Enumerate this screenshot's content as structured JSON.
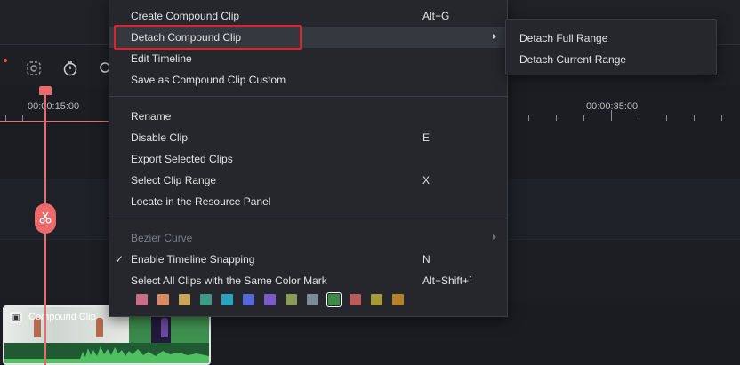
{
  "timeline": {
    "ruler_labels": [
      "00:00:15:00",
      "00:00:35:00"
    ],
    "clip_title": "Compound Clip"
  },
  "context_menu": {
    "items": [
      {
        "label": "Create Compound Clip",
        "shortcut": "Alt+G"
      },
      {
        "label": "Detach Compound Clip",
        "shortcut": ""
      },
      {
        "label": "Edit Timeline",
        "shortcut": ""
      },
      {
        "label": "Save as Compound Clip Custom",
        "shortcut": ""
      },
      {
        "label": "Rename",
        "shortcut": ""
      },
      {
        "label": "Disable Clip",
        "shortcut": "E"
      },
      {
        "label": "Export Selected Clips",
        "shortcut": ""
      },
      {
        "label": "Select Clip Range",
        "shortcut": "X"
      },
      {
        "label": "Locate in the Resource Panel",
        "shortcut": ""
      },
      {
        "label": "Bezier Curve",
        "shortcut": ""
      },
      {
        "label": "Enable Timeline Snapping",
        "shortcut": "N"
      },
      {
        "label": "Select All Clips with the Same Color Mark",
        "shortcut": "Alt+Shift+`"
      }
    ],
    "highlighted_item": "Detach Compound Clip",
    "color_marks": [
      "#c76f8a",
      "#d98a5f",
      "#c9a45c",
      "#3f9a85",
      "#2aa3bd",
      "#5469d6",
      "#7a5bc7",
      "#8b9a59",
      "#7d8b94",
      "#3c8a45",
      "#b85c5c",
      "#a39a3a",
      "#b4822a"
    ],
    "selected_color_index": 9
  },
  "submenu": {
    "items": [
      {
        "label": "Detach Full Range"
      },
      {
        "label": "Detach Current Range"
      }
    ]
  }
}
